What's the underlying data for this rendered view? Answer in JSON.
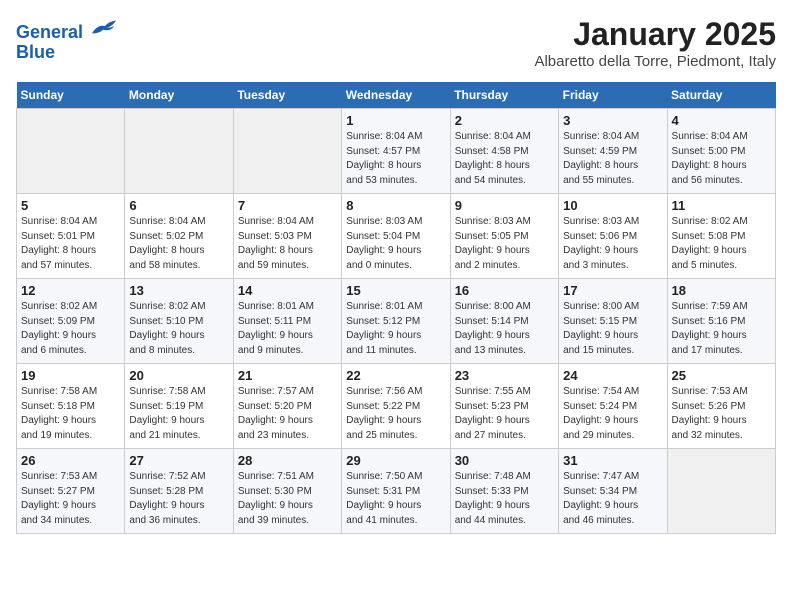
{
  "header": {
    "logo_line1": "General",
    "logo_line2": "Blue",
    "month_title": "January 2025",
    "location": "Albaretto della Torre, Piedmont, Italy"
  },
  "weekdays": [
    "Sunday",
    "Monday",
    "Tuesday",
    "Wednesday",
    "Thursday",
    "Friday",
    "Saturday"
  ],
  "weeks": [
    [
      {
        "day": "",
        "info": ""
      },
      {
        "day": "",
        "info": ""
      },
      {
        "day": "",
        "info": ""
      },
      {
        "day": "1",
        "info": "Sunrise: 8:04 AM\nSunset: 4:57 PM\nDaylight: 8 hours\nand 53 minutes."
      },
      {
        "day": "2",
        "info": "Sunrise: 8:04 AM\nSunset: 4:58 PM\nDaylight: 8 hours\nand 54 minutes."
      },
      {
        "day": "3",
        "info": "Sunrise: 8:04 AM\nSunset: 4:59 PM\nDaylight: 8 hours\nand 55 minutes."
      },
      {
        "day": "4",
        "info": "Sunrise: 8:04 AM\nSunset: 5:00 PM\nDaylight: 8 hours\nand 56 minutes."
      }
    ],
    [
      {
        "day": "5",
        "info": "Sunrise: 8:04 AM\nSunset: 5:01 PM\nDaylight: 8 hours\nand 57 minutes."
      },
      {
        "day": "6",
        "info": "Sunrise: 8:04 AM\nSunset: 5:02 PM\nDaylight: 8 hours\nand 58 minutes."
      },
      {
        "day": "7",
        "info": "Sunrise: 8:04 AM\nSunset: 5:03 PM\nDaylight: 8 hours\nand 59 minutes."
      },
      {
        "day": "8",
        "info": "Sunrise: 8:03 AM\nSunset: 5:04 PM\nDaylight: 9 hours\nand 0 minutes."
      },
      {
        "day": "9",
        "info": "Sunrise: 8:03 AM\nSunset: 5:05 PM\nDaylight: 9 hours\nand 2 minutes."
      },
      {
        "day": "10",
        "info": "Sunrise: 8:03 AM\nSunset: 5:06 PM\nDaylight: 9 hours\nand 3 minutes."
      },
      {
        "day": "11",
        "info": "Sunrise: 8:02 AM\nSunset: 5:08 PM\nDaylight: 9 hours\nand 5 minutes."
      }
    ],
    [
      {
        "day": "12",
        "info": "Sunrise: 8:02 AM\nSunset: 5:09 PM\nDaylight: 9 hours\nand 6 minutes."
      },
      {
        "day": "13",
        "info": "Sunrise: 8:02 AM\nSunset: 5:10 PM\nDaylight: 9 hours\nand 8 minutes."
      },
      {
        "day": "14",
        "info": "Sunrise: 8:01 AM\nSunset: 5:11 PM\nDaylight: 9 hours\nand 9 minutes."
      },
      {
        "day": "15",
        "info": "Sunrise: 8:01 AM\nSunset: 5:12 PM\nDaylight: 9 hours\nand 11 minutes."
      },
      {
        "day": "16",
        "info": "Sunrise: 8:00 AM\nSunset: 5:14 PM\nDaylight: 9 hours\nand 13 minutes."
      },
      {
        "day": "17",
        "info": "Sunrise: 8:00 AM\nSunset: 5:15 PM\nDaylight: 9 hours\nand 15 minutes."
      },
      {
        "day": "18",
        "info": "Sunrise: 7:59 AM\nSunset: 5:16 PM\nDaylight: 9 hours\nand 17 minutes."
      }
    ],
    [
      {
        "day": "19",
        "info": "Sunrise: 7:58 AM\nSunset: 5:18 PM\nDaylight: 9 hours\nand 19 minutes."
      },
      {
        "day": "20",
        "info": "Sunrise: 7:58 AM\nSunset: 5:19 PM\nDaylight: 9 hours\nand 21 minutes."
      },
      {
        "day": "21",
        "info": "Sunrise: 7:57 AM\nSunset: 5:20 PM\nDaylight: 9 hours\nand 23 minutes."
      },
      {
        "day": "22",
        "info": "Sunrise: 7:56 AM\nSunset: 5:22 PM\nDaylight: 9 hours\nand 25 minutes."
      },
      {
        "day": "23",
        "info": "Sunrise: 7:55 AM\nSunset: 5:23 PM\nDaylight: 9 hours\nand 27 minutes."
      },
      {
        "day": "24",
        "info": "Sunrise: 7:54 AM\nSunset: 5:24 PM\nDaylight: 9 hours\nand 29 minutes."
      },
      {
        "day": "25",
        "info": "Sunrise: 7:53 AM\nSunset: 5:26 PM\nDaylight: 9 hours\nand 32 minutes."
      }
    ],
    [
      {
        "day": "26",
        "info": "Sunrise: 7:53 AM\nSunset: 5:27 PM\nDaylight: 9 hours\nand 34 minutes."
      },
      {
        "day": "27",
        "info": "Sunrise: 7:52 AM\nSunset: 5:28 PM\nDaylight: 9 hours\nand 36 minutes."
      },
      {
        "day": "28",
        "info": "Sunrise: 7:51 AM\nSunset: 5:30 PM\nDaylight: 9 hours\nand 39 minutes."
      },
      {
        "day": "29",
        "info": "Sunrise: 7:50 AM\nSunset: 5:31 PM\nDaylight: 9 hours\nand 41 minutes."
      },
      {
        "day": "30",
        "info": "Sunrise: 7:48 AM\nSunset: 5:33 PM\nDaylight: 9 hours\nand 44 minutes."
      },
      {
        "day": "31",
        "info": "Sunrise: 7:47 AM\nSunset: 5:34 PM\nDaylight: 9 hours\nand 46 minutes."
      },
      {
        "day": "",
        "info": ""
      }
    ]
  ]
}
